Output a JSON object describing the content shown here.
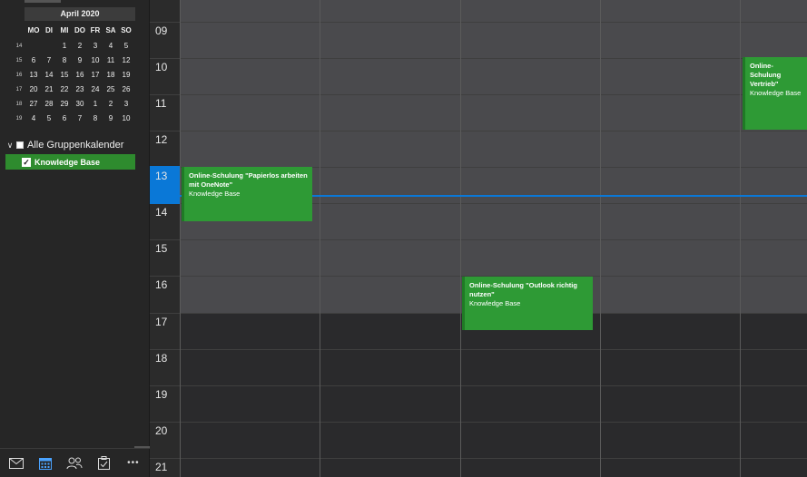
{
  "mini_calendar": {
    "month_label": "April 2020",
    "weekdays": [
      "MO",
      "DI",
      "MI",
      "DO",
      "FR",
      "SA",
      "SO"
    ],
    "weeks": [
      {
        "num": "14",
        "days": [
          "",
          "",
          "1",
          "2",
          "3",
          "4",
          "5"
        ]
      },
      {
        "num": "15",
        "days": [
          "6",
          "7",
          "8",
          "9",
          "10",
          "11",
          "12"
        ]
      },
      {
        "num": "16",
        "days": [
          "13",
          "14",
          "15",
          "16",
          "17",
          "18",
          "19"
        ]
      },
      {
        "num": "17",
        "days": [
          "20",
          "21",
          "22",
          "23",
          "24",
          "25",
          "26"
        ]
      },
      {
        "num": "18",
        "days": [
          "27",
          "28",
          "29",
          "30",
          "1",
          "2",
          "3"
        ]
      },
      {
        "num": "19",
        "days": [
          "4",
          "5",
          "6",
          "7",
          "8",
          "9",
          "10"
        ]
      }
    ]
  },
  "calendar_groups": {
    "group_label": "Alle Gruppenkalender",
    "items": [
      {
        "label": "Knowledge Base",
        "checked": true,
        "color": "#2e8b2e"
      }
    ]
  },
  "nav": {
    "items": [
      "mail-icon",
      "calendar-icon",
      "people-icon",
      "tasks-icon",
      "more-icon"
    ],
    "more_label": "•••"
  },
  "hours": [
    "09",
    "10",
    "11",
    "12",
    "13",
    "14",
    "15",
    "16",
    "17",
    "18",
    "19",
    "20",
    "21"
  ],
  "events": [
    {
      "title": "Online-Schulung \"Papierlos arbeiten mit OneNote\"",
      "calendar": "Knowledge Base"
    },
    {
      "title": "Online-Schulung \"Outlook richtig nutzen\"",
      "calendar": "Knowledge Base"
    },
    {
      "title": "Online-Schulung Vertrieb\"",
      "calendar": "Knowledge Base"
    }
  ],
  "colors": {
    "event": "#2e9a35",
    "now": "#0a78d7",
    "accent": "#4aa3ff"
  }
}
